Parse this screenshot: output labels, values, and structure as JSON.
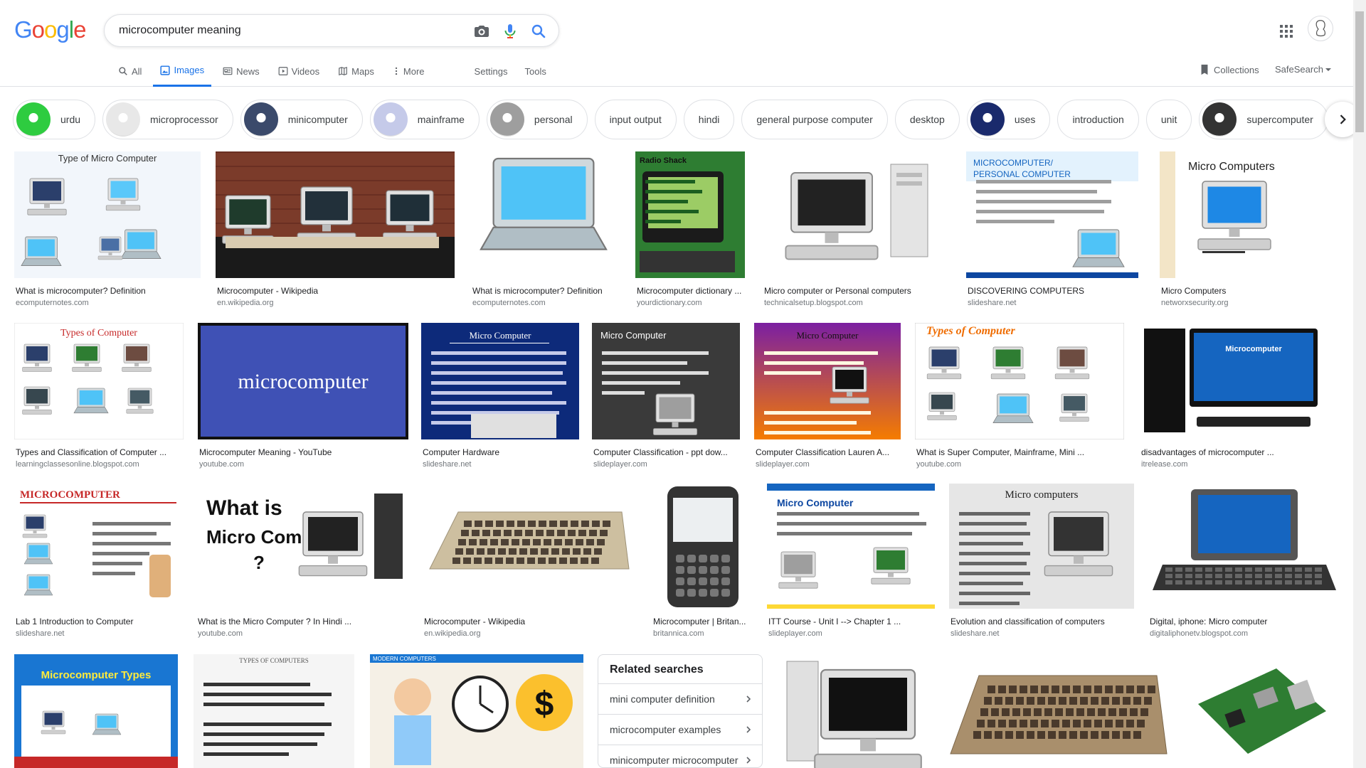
{
  "search": {
    "query": "microcomputer meaning"
  },
  "logo": {
    "text": "Google"
  },
  "tabs": [
    {
      "label": "All",
      "icon": "search-icon"
    },
    {
      "label": "Images",
      "icon": "image-icon",
      "active": true
    },
    {
      "label": "News",
      "icon": "news-icon"
    },
    {
      "label": "Videos",
      "icon": "video-icon"
    },
    {
      "label": "Maps",
      "icon": "maps-icon"
    },
    {
      "label": "More",
      "icon": "more-vert-icon"
    }
  ],
  "tools": {
    "settings": "Settings",
    "tools": "Tools",
    "collections": "Collections",
    "safesearch": "SafeSearch"
  },
  "chips": [
    {
      "label": "urdu",
      "thumb": "#2ecc40"
    },
    {
      "label": "microprocessor",
      "thumb": "#e8e8e8"
    },
    {
      "label": "minicomputer",
      "thumb": "#3b4a6b"
    },
    {
      "label": "mainframe",
      "thumb": "#c5cae9"
    },
    {
      "label": "personal",
      "thumb": "#9e9e9e"
    },
    {
      "label": "input output"
    },
    {
      "label": "hindi"
    },
    {
      "label": "general purpose computer"
    },
    {
      "label": "desktop"
    },
    {
      "label": "uses",
      "thumb": "#1a2a6c"
    },
    {
      "label": "introduction"
    },
    {
      "label": "unit"
    },
    {
      "label": "supercomputer",
      "thumb": "#333333"
    }
  ],
  "results": [
    {
      "title": "What is microcomputer? Definition",
      "source": "ecomputernotes.com",
      "img_text": "Type of Micro Computer"
    },
    {
      "title": "Microcomputer - Wikipedia",
      "source": "en.wikipedia.org"
    },
    {
      "title": "What is microcomputer? Definition",
      "source": "ecomputernotes.com"
    },
    {
      "title": "Microcomputer dictionary ...",
      "source": "yourdictionary.com",
      "img_text": "Radio Shack"
    },
    {
      "title": "Micro computer or Personal computers",
      "source": "technicalsetup.blogspot.com"
    },
    {
      "title": "DISCOVERING COMPUTERS",
      "source": "slideshare.net",
      "img_text": "MICROCOMPUTER/PERSONAL COMPUTER"
    },
    {
      "title": "Micro Computers",
      "source": "networxsecurity.org",
      "img_text": "Micro Computers"
    },
    {
      "title": "Types and Classification of Computer ...",
      "source": "learningclassesonline.blogspot.com",
      "img_text": "Types of Computer"
    },
    {
      "title": "Microcomputer Meaning - YouTube",
      "source": "youtube.com",
      "img_text": "microcomputer"
    },
    {
      "title": "Computer Hardware",
      "source": "slideshare.net",
      "img_text": "Micro Computer"
    },
    {
      "title": "Computer Classification - ppt dow...",
      "source": "slideplayer.com",
      "img_text": "Micro Computer"
    },
    {
      "title": "Computer Classification Lauren A...",
      "source": "slideplayer.com",
      "img_text": "Micro Computer"
    },
    {
      "title": "What is Super Computer, Mainframe, Mini ...",
      "source": "youtube.com",
      "img_text": "Types of Computer"
    },
    {
      "title": "disadvantages of microcomputer ...",
      "source": "itrelease.com",
      "img_text": "Microcomputer"
    },
    {
      "title": "Lab 1 Introduction to Computer",
      "source": "slideshare.net",
      "img_text": "MICROCOMPUTER"
    },
    {
      "title": "What is the Micro Computer ? In Hindi ...",
      "source": "youtube.com",
      "img_text": "What is Micro Computer ?"
    },
    {
      "title": "Microcomputer - Wikipedia",
      "source": "en.wikipedia.org"
    },
    {
      "title": "Microcomputer | Britan...",
      "source": "britannica.com"
    },
    {
      "title": "ITT Course - Unit I --> Chapter 1 ...",
      "source": "slideplayer.com",
      "img_text": "Micro Computer"
    },
    {
      "title": "Evolution and classification of computers",
      "source": "slideshare.net",
      "img_text": "Micro computers"
    },
    {
      "title": "Digital, iphone: Micro computer",
      "source": "digitaliphonetv.blogspot.com"
    },
    {
      "img_text": "Microcomputer Types"
    },
    {
      "img_text": "TYPES OF COMPUTERS"
    },
    {
      "img_text": "MODERN COMPUTERS"
    },
    {},
    {},
    {}
  ],
  "related": {
    "heading": "Related searches",
    "items": [
      "mini computer definition",
      "microcomputer examples",
      "minicomputer microcomputer"
    ]
  },
  "colors": {
    "blue": "#4285F4",
    "red": "#EA4335",
    "yellow": "#FBBC05",
    "green": "#34A853",
    "active_tab": "#1a73e8"
  }
}
